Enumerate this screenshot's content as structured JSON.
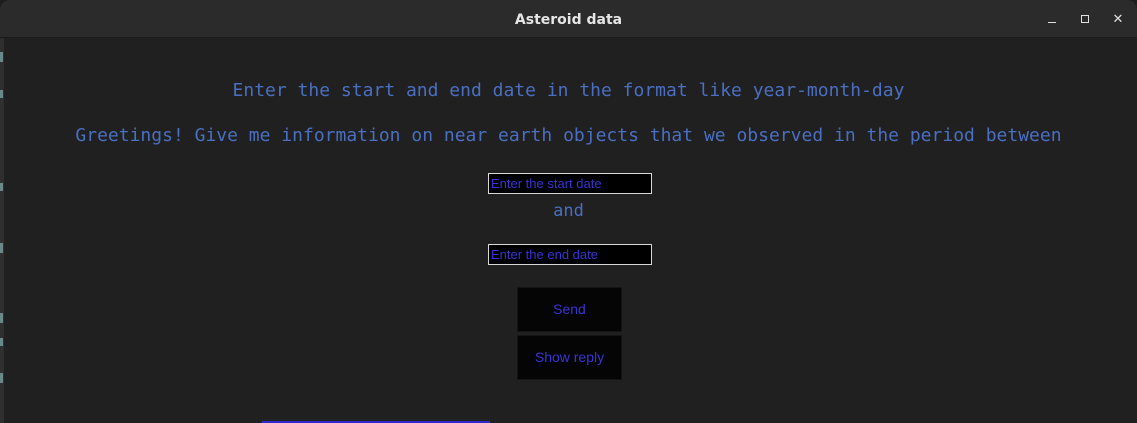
{
  "window": {
    "title": "Asteroid data"
  },
  "instructions": {
    "line1": "Enter the start and end date in the format like year-month-day",
    "line2": "Greetings! Give me information on near earth objects that we observed in the period between"
  },
  "form": {
    "start_placeholder": "Enter the start date",
    "and_label": "and",
    "end_placeholder": "Enter the end date",
    "send_label": "Send",
    "reply_label": "Show reply"
  },
  "colors": {
    "text_accent": "#4a6fc2",
    "input_text": "#3a32d6",
    "background": "#202020"
  }
}
